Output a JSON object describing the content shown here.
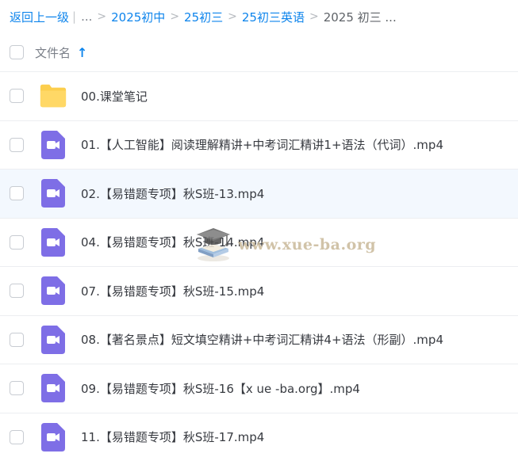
{
  "breadcrumb": {
    "back_label": "返回上一级",
    "ellipsis": "...",
    "items": [
      "2025初中",
      "25初三",
      "25初三英语"
    ],
    "current": "2025 初三 ..."
  },
  "header": {
    "name_label": "文件名",
    "sort_icon": "arrow-up-icon"
  },
  "files": [
    {
      "name": "00.课堂笔记",
      "type": "folder"
    },
    {
      "name": "01.【人工智能】阅读理解精讲+中考词汇精讲1+语法（代词）.mp4",
      "type": "video"
    },
    {
      "name": "02.【易错题专项】秋S班-13.mp4",
      "type": "video"
    },
    {
      "name": "04.【易错题专项】秋S班-14.mp4",
      "type": "video"
    },
    {
      "name": "07.【易错题专项】秋S班-15.mp4",
      "type": "video"
    },
    {
      "name": "08.【著名景点】短文填空精讲+中考词汇精讲4+语法（形副）.mp4",
      "type": "video"
    },
    {
      "name": "09.【易错题专项】秋S班-16【x ue -ba.org】.mp4",
      "type": "video"
    },
    {
      "name": "11.【易错题专项】秋S班-17.mp4",
      "type": "video"
    }
  ],
  "watermark": {
    "text": "www.xue-ba.org",
    "icon": "graduation-cap-book-icon"
  },
  "colors": {
    "link": "#0d84ec",
    "video_icon": "#7e6ee6",
    "folder_icon": "#fcce4d",
    "row_highlight": "#f3f8fe"
  }
}
